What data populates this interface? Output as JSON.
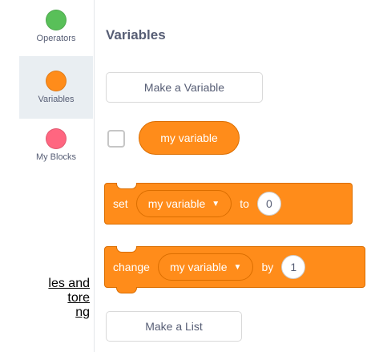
{
  "sidebar": {
    "categories": [
      {
        "label": "Operators",
        "color": "#59c059"
      },
      {
        "label": "Variables",
        "color": "#ff8c1a",
        "selected": true
      },
      {
        "label": "My Blocks",
        "color": "#ff6680"
      }
    ]
  },
  "palette": {
    "title": "Variables",
    "make_variable": "Make a Variable",
    "variable_reporter": "my variable",
    "set_block": {
      "word": "set",
      "variable": "my variable",
      "to_word": "to",
      "value": "0"
    },
    "change_block": {
      "word": "change",
      "variable": "my variable",
      "by_word": "by",
      "value": "1"
    },
    "make_list": "Make a List"
  },
  "caption_lines": [
    "les and",
    "tore",
    "ng"
  ],
  "colors": {
    "accent": "#ff8c1a",
    "accent_border": "#db6e00"
  }
}
